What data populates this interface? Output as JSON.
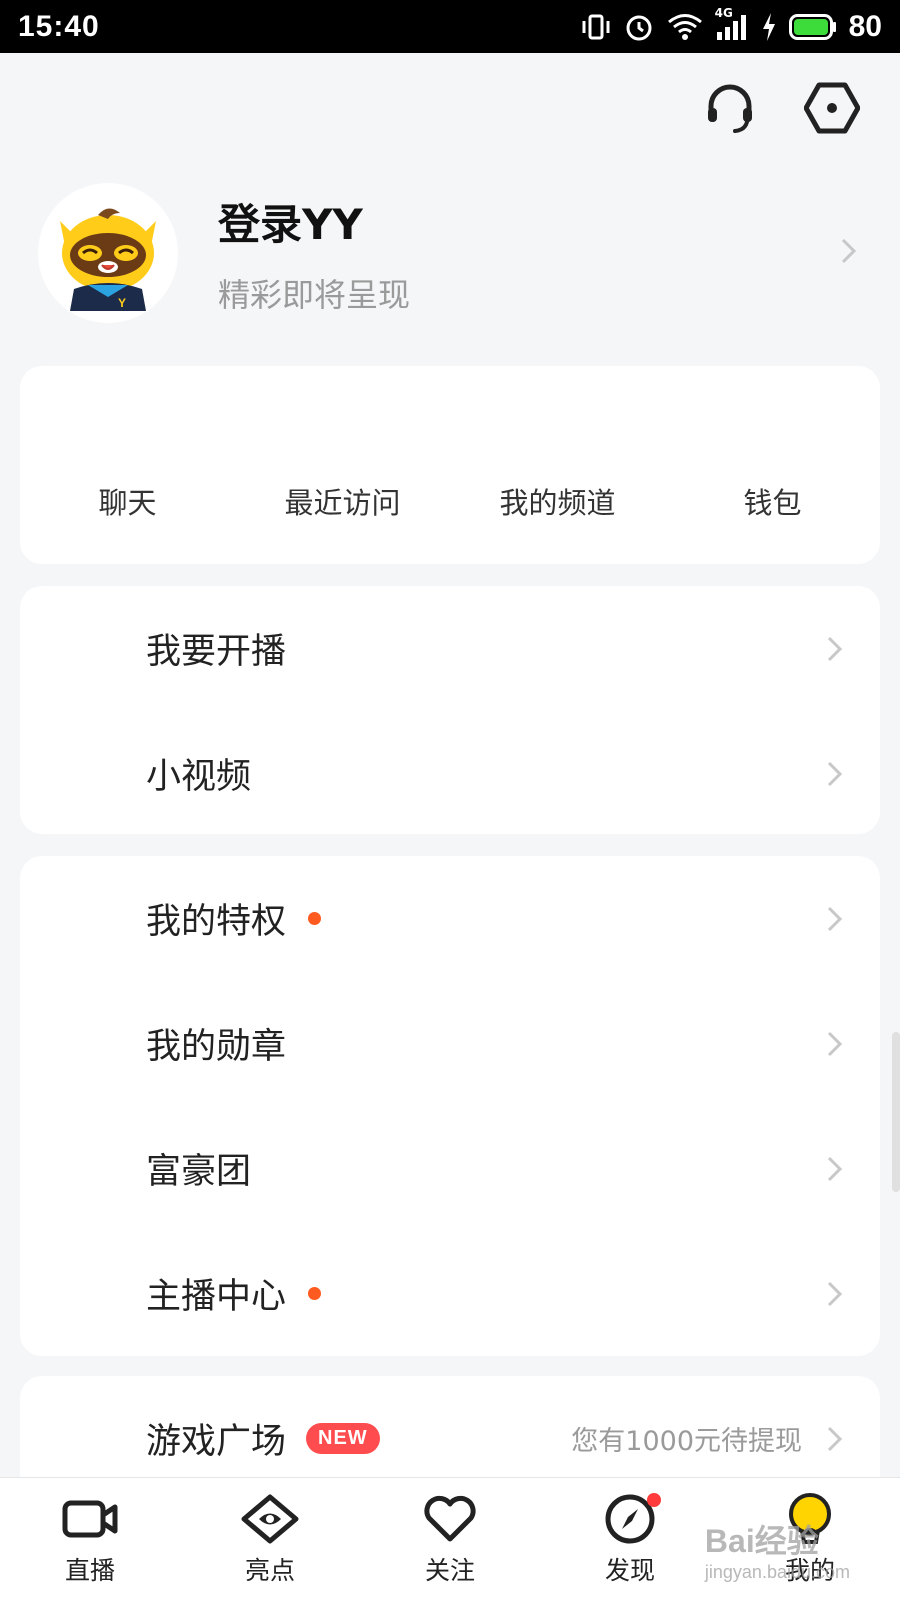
{
  "status_bar": {
    "time": "15:40",
    "network": "4G",
    "battery": "80",
    "icons": [
      "vibrate-icon",
      "alarm-icon",
      "wifi-icon",
      "signal-icon",
      "charging-icon",
      "battery-icon"
    ]
  },
  "header": {
    "icons": [
      "headset-icon",
      "settings-hexagon-icon"
    ]
  },
  "profile": {
    "title": "登录YY",
    "subtitle": "精彩即将呈现"
  },
  "quick_actions": [
    {
      "label": "聊天"
    },
    {
      "label": "最近访问"
    },
    {
      "label": "我的频道"
    },
    {
      "label": "钱包"
    }
  ],
  "live_section": [
    {
      "label": "我要开播"
    },
    {
      "label": "小视频"
    }
  ],
  "privileges_section": [
    {
      "label": "我的特权",
      "dot": true
    },
    {
      "label": "我的勋章",
      "dot": false
    },
    {
      "label": "富豪团",
      "dot": false
    },
    {
      "label": "主播中心",
      "dot": true
    }
  ],
  "game_section": {
    "label": "游戏广场",
    "badge": "NEW",
    "note": "您有1000元待提现"
  },
  "bottom_nav": [
    {
      "label": "直播",
      "icon": "camera-icon"
    },
    {
      "label": "亮点",
      "icon": "eye-icon"
    },
    {
      "label": "关注",
      "icon": "heart-icon"
    },
    {
      "label": "发现",
      "icon": "compass-icon"
    },
    {
      "label": "我的",
      "icon": "mine-icon",
      "active": true
    }
  ],
  "watermark": {
    "brand": "Bai经验",
    "url": "jingyan.baidu.com"
  },
  "colors": {
    "accent_dot": "#ff5a1f",
    "badge": "#ff4d4f",
    "active_nav": "#ffd400"
  }
}
